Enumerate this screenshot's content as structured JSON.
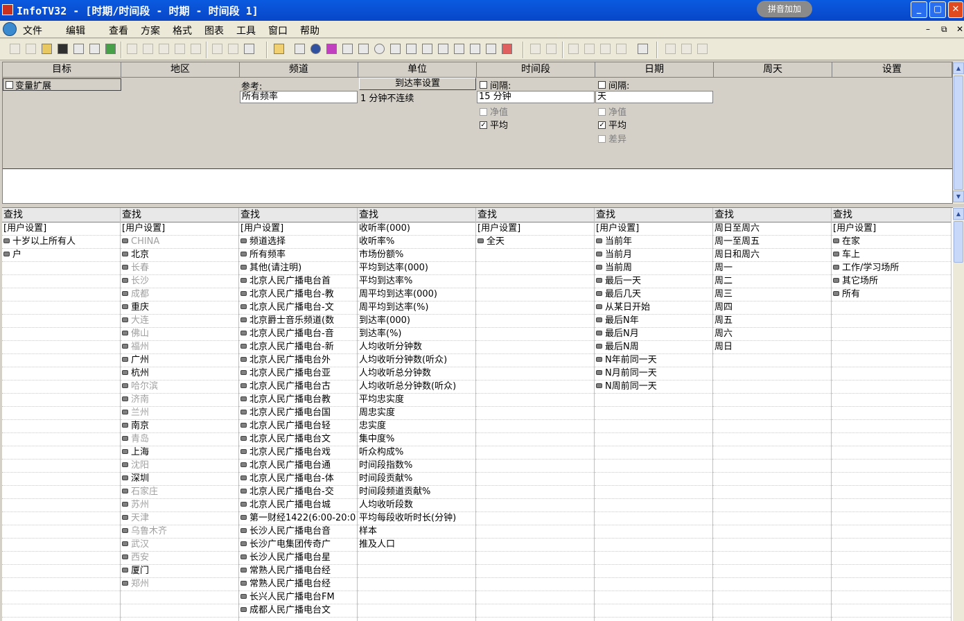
{
  "window": {
    "title": "InfoTV32 - [时期/时间段 - 时期 - 时间段 1]",
    "ime_label": "拼音加加"
  },
  "menu": [
    "文件",
    "编辑",
    "查看",
    "方案",
    "格式",
    "图表",
    "工具",
    "窗口",
    "帮助"
  ],
  "top_panel": {
    "headers": [
      "目标",
      "地区",
      "频道",
      "单位",
      "时间段",
      "日期",
      "周天",
      "设置"
    ],
    "target": {
      "expand_label": "变量扩展"
    },
    "channel": {
      "ref_label": "参考:",
      "ref_value": "所有频率"
    },
    "unit": {
      "button": "到达率设置",
      "value": "1 分钟不连续"
    },
    "timeslot": {
      "interval_label": "间隔:",
      "interval_value": "15 分钟",
      "net_label": "净值",
      "avg_label": "平均"
    },
    "date": {
      "interval_label": "间隔:",
      "interval_value": "天",
      "net_label": "净值",
      "avg_label": "平均",
      "diff_label": "差异"
    }
  },
  "find_label": "查找",
  "lists": {
    "target": [
      {
        "text": "[用户设置]",
        "icon": false
      },
      {
        "text": "十岁以上所有人",
        "icon": true
      },
      {
        "text": "户",
        "icon": true
      }
    ],
    "region": [
      {
        "text": "[用户设置]",
        "icon": false
      },
      {
        "text": "CHINA",
        "icon": true,
        "dim": true
      },
      {
        "text": "北京",
        "icon": true
      },
      {
        "text": "长春",
        "icon": true,
        "dim": true
      },
      {
        "text": "长沙",
        "icon": true,
        "dim": true
      },
      {
        "text": "成都",
        "icon": true,
        "dim": true
      },
      {
        "text": "重庆",
        "icon": true
      },
      {
        "text": "大连",
        "icon": true,
        "dim": true
      },
      {
        "text": "佛山",
        "icon": true,
        "dim": true
      },
      {
        "text": "福州",
        "icon": true,
        "dim": true
      },
      {
        "text": "广州",
        "icon": true
      },
      {
        "text": "杭州",
        "icon": true
      },
      {
        "text": "哈尔滨",
        "icon": true,
        "dim": true
      },
      {
        "text": "济南",
        "icon": true,
        "dim": true
      },
      {
        "text": "兰州",
        "icon": true,
        "dim": true
      },
      {
        "text": "南京",
        "icon": true
      },
      {
        "text": "青岛",
        "icon": true,
        "dim": true
      },
      {
        "text": "上海",
        "icon": true
      },
      {
        "text": "沈阳",
        "icon": true,
        "dim": true
      },
      {
        "text": "深圳",
        "icon": true
      },
      {
        "text": "石家庄",
        "icon": true,
        "dim": true
      },
      {
        "text": "苏州",
        "icon": true,
        "dim": true
      },
      {
        "text": "天津",
        "icon": true,
        "dim": true
      },
      {
        "text": "乌鲁木齐",
        "icon": true,
        "dim": true
      },
      {
        "text": "武汉",
        "icon": true,
        "dim": true
      },
      {
        "text": "西安",
        "icon": true,
        "dim": true
      },
      {
        "text": "厦门",
        "icon": true
      },
      {
        "text": "郑州",
        "icon": true,
        "dim": true
      }
    ],
    "channel": [
      {
        "text": "[用户设置]",
        "icon": false
      },
      {
        "text": "频道选择",
        "icon": true
      },
      {
        "text": "所有频率",
        "icon": true
      },
      {
        "text": "其他(请注明)",
        "icon": true
      },
      {
        "text": "北京人民广播电台首",
        "icon": true
      },
      {
        "text": "北京人民广播电台-教",
        "icon": true
      },
      {
        "text": "北京人民广播电台-文",
        "icon": true
      },
      {
        "text": "北京爵士音乐频道(数",
        "icon": true
      },
      {
        "text": "北京人民广播电台-音",
        "icon": true
      },
      {
        "text": "北京人民广播电台-新",
        "icon": true
      },
      {
        "text": "北京人民广播电台外",
        "icon": true
      },
      {
        "text": "北京人民广播电台亚",
        "icon": true
      },
      {
        "text": "北京人民广播电台古",
        "icon": true
      },
      {
        "text": "北京人民广播电台教",
        "icon": true
      },
      {
        "text": "北京人民广播电台国",
        "icon": true
      },
      {
        "text": "北京人民广播电台轻",
        "icon": true
      },
      {
        "text": "北京人民广播电台文",
        "icon": true
      },
      {
        "text": "北京人民广播电台戏",
        "icon": true
      },
      {
        "text": "北京人民广播电台通",
        "icon": true
      },
      {
        "text": "北京人民广播电台-体",
        "icon": true
      },
      {
        "text": "北京人民广播电台-交",
        "icon": true
      },
      {
        "text": "北京人民广播电台城",
        "icon": true
      },
      {
        "text": "第一财经1422(6:00-20:0",
        "icon": true
      },
      {
        "text": "长沙人民广播电台音",
        "icon": true
      },
      {
        "text": "长沙广电集团传奇广",
        "icon": true
      },
      {
        "text": "长沙人民广播电台星",
        "icon": true
      },
      {
        "text": "常熟人民广播电台经",
        "icon": true
      },
      {
        "text": "常熟人民广播电台经",
        "icon": true
      },
      {
        "text": "长兴人民广播电台FM",
        "icon": true
      },
      {
        "text": "成都人民广播电台文",
        "icon": true
      }
    ],
    "unit": [
      {
        "text": "收听率(000)",
        "icon": false
      },
      {
        "text": "收听率%",
        "icon": false
      },
      {
        "text": "市场份额%",
        "icon": false
      },
      {
        "text": "平均到达率(000)",
        "icon": false
      },
      {
        "text": "平均到达率%",
        "icon": false
      },
      {
        "text": "周平均到达率(000)",
        "icon": false
      },
      {
        "text": "周平均到达率(%)",
        "icon": false
      },
      {
        "text": "到达率(000)",
        "icon": false
      },
      {
        "text": "到达率(%)",
        "icon": false
      },
      {
        "text": "人均收听分钟数",
        "icon": false
      },
      {
        "text": "人均收听分钟数(听众)",
        "icon": false
      },
      {
        "text": "人均收听总分钟数",
        "icon": false
      },
      {
        "text": "人均收听总分钟数(听众)",
        "icon": false
      },
      {
        "text": "平均忠实度",
        "icon": false
      },
      {
        "text": "周忠实度",
        "icon": false
      },
      {
        "text": "忠实度",
        "icon": false
      },
      {
        "text": "集中度%",
        "icon": false
      },
      {
        "text": "听众构成%",
        "icon": false
      },
      {
        "text": "时间段指数%",
        "icon": false
      },
      {
        "text": "时间段贡献%",
        "icon": false
      },
      {
        "text": "时间段频道贡献%",
        "icon": false
      },
      {
        "text": "人均收听段数",
        "icon": false
      },
      {
        "text": "平均每段收听时长(分钟)",
        "icon": false
      },
      {
        "text": "样本",
        "icon": false
      },
      {
        "text": "推及人口",
        "icon": false
      }
    ],
    "timeslot": [
      {
        "text": "[用户设置]",
        "icon": false
      },
      {
        "text": "全天",
        "icon": true
      }
    ],
    "date": [
      {
        "text": "[用户设置]",
        "icon": false
      },
      {
        "text": "当前年",
        "icon": true
      },
      {
        "text": "当前月",
        "icon": true
      },
      {
        "text": "当前周",
        "icon": true
      },
      {
        "text": "最后一天",
        "icon": true
      },
      {
        "text": "最后几天",
        "icon": true
      },
      {
        "text": "从某日开始",
        "icon": true
      },
      {
        "text": "最后N年",
        "icon": true
      },
      {
        "text": "最后N月",
        "icon": true
      },
      {
        "text": "最后N周",
        "icon": true
      },
      {
        "text": "N年前同一天",
        "icon": true
      },
      {
        "text": "N月前同一天",
        "icon": true
      },
      {
        "text": "N周前同一天",
        "icon": true
      }
    ],
    "weekday": [
      {
        "text": "周日至周六",
        "icon": false
      },
      {
        "text": "周一至周五",
        "icon": false
      },
      {
        "text": "周日和周六",
        "icon": false
      },
      {
        "text": "周一",
        "icon": false
      },
      {
        "text": "周二",
        "icon": false
      },
      {
        "text": "周三",
        "icon": false
      },
      {
        "text": "周四",
        "icon": false
      },
      {
        "text": "周五",
        "icon": false
      },
      {
        "text": "周六",
        "icon": false
      },
      {
        "text": "周日",
        "icon": false
      }
    ],
    "setting": [
      {
        "text": "[用户设置]",
        "icon": false
      },
      {
        "text": "在家",
        "icon": true
      },
      {
        "text": "车上",
        "icon": true
      },
      {
        "text": "工作/学习场所",
        "icon": true
      },
      {
        "text": "其它场所",
        "icon": true
      },
      {
        "text": "所有",
        "icon": true
      }
    ]
  }
}
